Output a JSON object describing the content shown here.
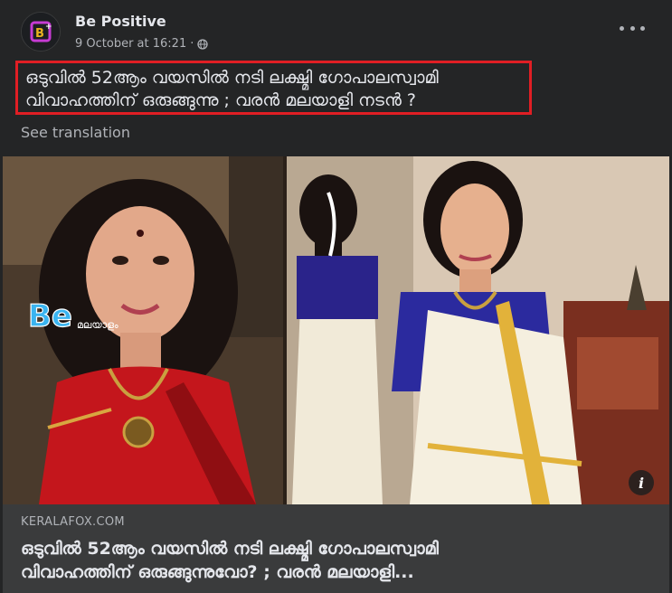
{
  "post": {
    "page_name": "Be Positive",
    "timestamp": "9 October at 16:21",
    "privacy_icon": "globe-icon",
    "more_icon": "more-horizontal-icon",
    "caption_line1": "ഒടുവിൽ 52ആം വയസിൽ നടി ലക്ഷ്മി ഗോപാലസ്വാമി",
    "caption_line2": "വിവാഹത്തിന് ഒരുങ്ങുന്നു ; വരൻ മലയാളി നടൻ ?",
    "see_translation": "See translation",
    "watermark_logo": "Be",
    "watermark_text": "മലയാളം"
  },
  "link_preview": {
    "domain": "KERALAFOX.COM",
    "title_line1": "ഒടുവിൽ 52ആം വയസിൽ നടി ലക്ഷ്മി ഗോപാലസ്വാമി",
    "title_line2": "വിവാഹത്തിന് ഒരുങ്ങുന്നുവോ? ; വരൻ മലയാളി...",
    "info_label": "i"
  },
  "colors": {
    "background": "#242526",
    "highlight_border": "#e01e24",
    "link_box": "#3a3b3c"
  }
}
